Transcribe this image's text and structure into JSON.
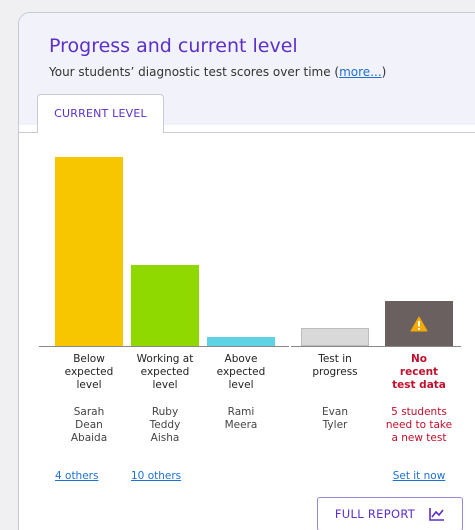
{
  "header": {
    "title": "Progress and current level",
    "subtitle_prefix": "Your students’ diagnostic test scores over time (",
    "subtitle_link": "more...",
    "subtitle_suffix": ")"
  },
  "tabs": [
    {
      "label": "CURRENT LEVEL",
      "active": true
    }
  ],
  "chart_data": {
    "type": "bar",
    "categories": [
      "Below expected level",
      "Working at expected level",
      "Above expected level",
      "Test in progress",
      "No recent test data"
    ],
    "values": [
      10.5,
      4.5,
      0.5,
      1,
      2.5
    ],
    "colors": [
      "#f7c600",
      "#8fd800",
      "#5ed3e3",
      "#d9d9d9",
      "#6b6060"
    ],
    "grid": false
  },
  "columns": [
    {
      "label_lines": [
        "Below",
        "expected",
        "level"
      ],
      "names": [
        "Sarah",
        "Dean",
        "Abaida"
      ],
      "link": "4 others",
      "alert": false
    },
    {
      "label_lines": [
        "Working at",
        "expected",
        "level"
      ],
      "names": [
        "Ruby",
        "Teddy",
        "Aisha"
      ],
      "link": "10 others",
      "alert": false
    },
    {
      "label_lines": [
        "Above",
        "expected",
        "level"
      ],
      "names": [
        "Rami",
        "Meera"
      ],
      "link": "",
      "alert": false
    },
    {
      "label_lines": [
        "Test in",
        "progress"
      ],
      "names": [
        "Evan",
        "Tyler"
      ],
      "link": "",
      "alert": false
    },
    {
      "label_lines": [
        "No",
        "recent",
        "test data"
      ],
      "names": [
        "5 students",
        "need to take",
        "a new test"
      ],
      "link": "Set it now",
      "alert": true
    }
  ],
  "footer": {
    "full_report_label": "FULL REPORT",
    "full_report_icon": "line-chart-icon"
  },
  "icons": {
    "warning": "warning-icon"
  },
  "colors": {
    "accent": "#5b2fc9",
    "link": "#2070d0",
    "alert": "#c0102c"
  }
}
